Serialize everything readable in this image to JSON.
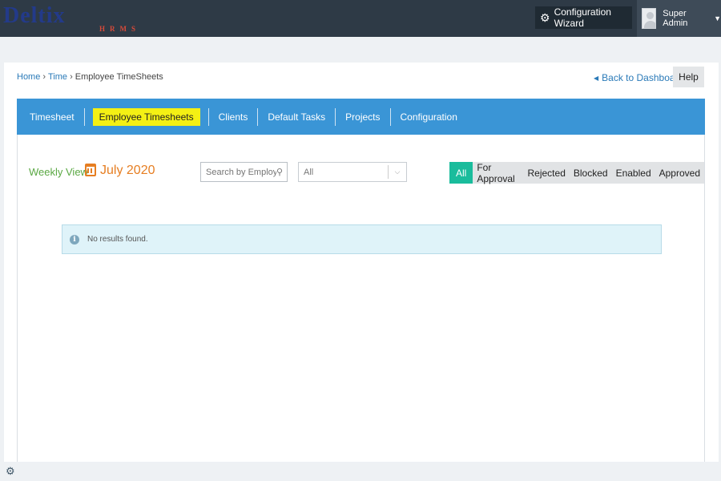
{
  "header": {
    "logo_text": "Deltix",
    "logo_subtext": "HRMS",
    "config_wizard_label": "Configuration Wizard",
    "user_name": "Super Admin"
  },
  "breadcrumb": {
    "home": "Home",
    "time": "Time",
    "current": "Employee TimeSheets",
    "separator": "›"
  },
  "actions": {
    "back_label": "Back to Dashboard",
    "help_label": "Help"
  },
  "tabs": [
    {
      "label": "Timesheet"
    },
    {
      "label": "Employee Timesheets",
      "active": true
    },
    {
      "label": "Clients"
    },
    {
      "label": "Default Tasks"
    },
    {
      "label": "Projects"
    },
    {
      "label": "Configuration"
    }
  ],
  "view": {
    "label": "Weekly View",
    "month": "July 2020"
  },
  "search": {
    "placeholder": "Search by Employee"
  },
  "select": {
    "value": "All"
  },
  "filters": [
    {
      "label": "All",
      "active": true
    },
    {
      "label": "For Approval"
    },
    {
      "label": "Rejected"
    },
    {
      "label": "Blocked"
    },
    {
      "label": "Enabled"
    },
    {
      "label": "Approved"
    }
  ],
  "alert": {
    "text": "No results found."
  },
  "colors": {
    "topbar": "#2e3a46",
    "tabs_bar": "#3a95d6",
    "active_tab": "#f4f014",
    "active_filter": "#1abc9c",
    "weekly_view": "#5aa843",
    "month": "#e67e22"
  }
}
